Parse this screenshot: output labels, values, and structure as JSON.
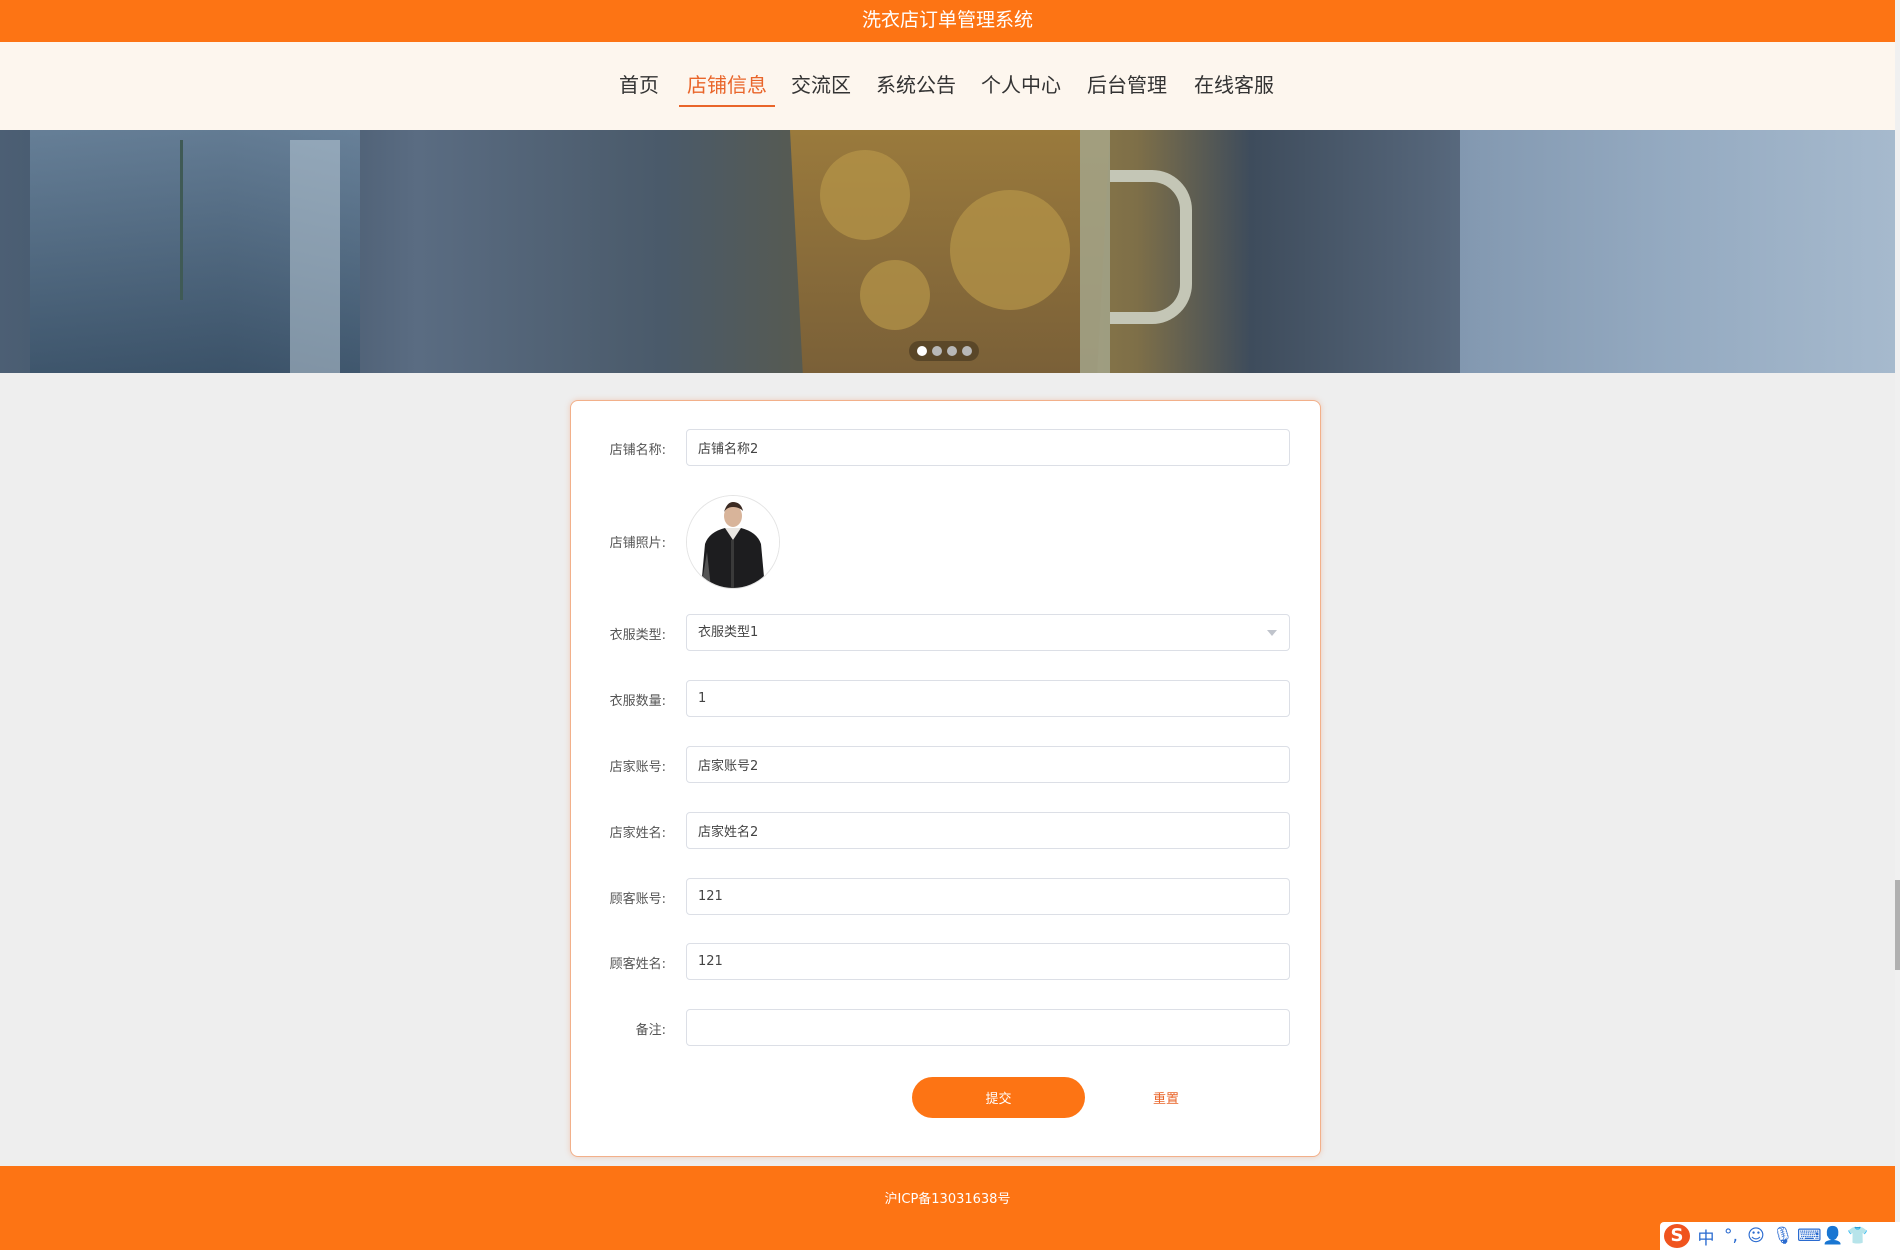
{
  "app": {
    "title": "洗衣店订单管理系统"
  },
  "nav": {
    "items": [
      {
        "label": "首页"
      },
      {
        "label": "店铺信息",
        "active": true
      },
      {
        "label": "交流区"
      },
      {
        "label": "系统公告"
      },
      {
        "label": "个人中心"
      },
      {
        "label": "后台管理"
      },
      {
        "label": "在线客服"
      }
    ]
  },
  "carousel": {
    "dot_count": 4,
    "active_index": 0
  },
  "form": {
    "shop_name": {
      "label": "店铺名称:",
      "value": "店铺名称2"
    },
    "shop_photo": {
      "label": "店铺照片:",
      "image": "man-in-black-jacket-photo"
    },
    "clothes_type": {
      "label": "衣服类型:",
      "value": "衣服类型1",
      "icon": "chevron-down-icon"
    },
    "clothes_count": {
      "label": "衣服数量:",
      "value": "1"
    },
    "merchant_account": {
      "label": "店家账号:",
      "value": "店家账号2"
    },
    "merchant_name": {
      "label": "店家姓名:",
      "value": "店家姓名2"
    },
    "customer_account": {
      "label": "顾客账号:",
      "value": "121"
    },
    "customer_name": {
      "label": "顾客姓名:",
      "value": "121"
    },
    "remark": {
      "label": "备注:",
      "value": ""
    },
    "submit_label": "提交",
    "reset_label": "重置"
  },
  "footer": {
    "text": "沪ICP备13031638号"
  },
  "ime": {
    "logo": "S",
    "mode": "中",
    "punct": "°,"
  },
  "colors": {
    "accent": "#fd7414",
    "nav_bg": "#fdf6ee",
    "active_text": "#e9652a",
    "page_bg": "#eeeeee"
  }
}
